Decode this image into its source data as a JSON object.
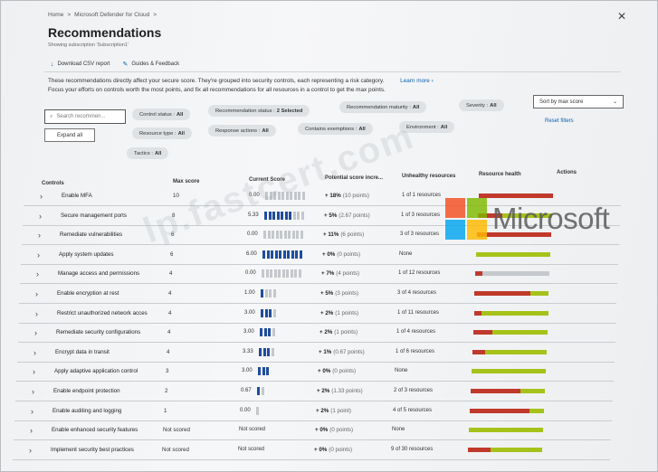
{
  "breadcrumb": [
    "Home",
    ">",
    "Microsoft Defender for Cloud",
    ">"
  ],
  "page": {
    "title": "Recommendations",
    "subtitle": "Showing subscription 'Subscription1'"
  },
  "commands": {
    "download": "Download CSV report",
    "guides": "Guides & Feedback"
  },
  "info": {
    "line1": "These recommendations directly affect your secure score. They're grouped into security controls, each representing a risk category.",
    "line2": "Focus your efforts on controls worth the most points, and fix all recommendations for all resources in a control to get the max points.",
    "learn_more": "Learn more ›"
  },
  "filters": {
    "search_placeholder": "Search recommen...",
    "expand_all": "Expand all",
    "reset": "Reset filters",
    "sort": "Sort by max score",
    "pills": [
      {
        "label": "Control status :",
        "value": "All"
      },
      {
        "label": "Recommendation status :",
        "value": "2 Selected"
      },
      {
        "label": "Recommendation maturity :",
        "value": "All"
      },
      {
        "label": "Severity :",
        "value": "All"
      },
      {
        "label": "Resource type :",
        "value": "All"
      },
      {
        "label": "Response actions :",
        "value": "All"
      },
      {
        "label": "Contains exemptions :",
        "value": "All"
      },
      {
        "label": "Environment :",
        "value": "All"
      },
      {
        "label": "Tactics :",
        "value": "All"
      }
    ]
  },
  "table": {
    "headers": {
      "controls": "Controls",
      "max": "Max score",
      "current": "Current Score",
      "potential": "Potential score incre...",
      "unhealthy": "Unhealthy resources",
      "health": "Resource health",
      "actions": "Actions"
    },
    "rows": [
      {
        "name": "Enable MFA",
        "max": "10",
        "current": "0.00",
        "bars_on": 0,
        "bars_total": 10,
        "potential": "+ 18%",
        "points": "(10 points)",
        "unhealthy": "1 of 1 resources",
        "health": [
          [
            "#c0392b",
            0.3
          ],
          [
            "#c0392b",
            0.7
          ]
        ]
      },
      {
        "name": "Secure management ports",
        "max": "8",
        "current": "5.33",
        "bars_on": 7,
        "bars_total": 10,
        "potential": "+ 5%",
        "points": "(2.67 points)",
        "unhealthy": "1 of 3 resources",
        "health": [
          [
            "#c0392b",
            0.33
          ],
          [
            "#a6c21a",
            0.67
          ]
        ]
      },
      {
        "name": "Remediate vulnerabilities",
        "max": "6",
        "current": "0.00",
        "bars_on": 0,
        "bars_total": 10,
        "potential": "+ 11%",
        "points": "(6 points)",
        "unhealthy": "3 of 3 resources",
        "health": [
          [
            "#c0392b",
            1.0
          ]
        ]
      },
      {
        "name": "Apply system updates",
        "max": "6",
        "current": "6.00",
        "bars_on": 10,
        "bars_total": 10,
        "potential": "+ 0%",
        "points": "(0 points)",
        "unhealthy": "None",
        "health": [
          [
            "#a6c21a",
            1.0
          ]
        ]
      },
      {
        "name": "Manage access and permissions",
        "max": "4",
        "current": "0.00",
        "bars_on": 0,
        "bars_total": 10,
        "potential": "+ 7%",
        "points": "(4 points)",
        "unhealthy": "1 of 12 resources",
        "health": [
          [
            "#c0392b",
            0.1
          ],
          [
            "#c5c8cc",
            0.9
          ]
        ]
      },
      {
        "name": "Enable encryption at rest",
        "max": "4",
        "current": "1.00",
        "bars_on": 1,
        "bars_total": 4,
        "potential": "+ 5%",
        "points": "(3 points)",
        "unhealthy": "3 of 4 resources",
        "health": [
          [
            "#c0392b",
            0.75
          ],
          [
            "#a6c21a",
            0.25
          ]
        ]
      },
      {
        "name": "Restrict unauthorized network acces",
        "max": "4",
        "current": "3.00",
        "bars_on": 3,
        "bars_total": 4,
        "potential": "+ 2%",
        "points": "(1 points)",
        "unhealthy": "1 of 11 resources",
        "health": [
          [
            "#c0392b",
            0.1
          ],
          [
            "#a6c21a",
            0.9
          ]
        ]
      },
      {
        "name": "Remediate security configurations",
        "max": "4",
        "current": "3.00",
        "bars_on": 3,
        "bars_total": 4,
        "potential": "+ 2%",
        "points": "(1 points)",
        "unhealthy": "1 of 4 resources",
        "health": [
          [
            "#c0392b",
            0.25
          ],
          [
            "#a6c21a",
            0.75
          ]
        ]
      },
      {
        "name": "Encrypt data in transit",
        "max": "4",
        "current": "3.33",
        "bars_on": 3,
        "bars_total": 4,
        "potential": "+ 1%",
        "points": "(0.67 points)",
        "unhealthy": "1 of 6 resources",
        "health": [
          [
            "#c0392b",
            0.17
          ],
          [
            "#a6c21a",
            0.83
          ]
        ]
      },
      {
        "name": "Apply adaptive application control",
        "max": "3",
        "current": "3.00",
        "bars_on": 3,
        "bars_total": 3,
        "potential": "+ 0%",
        "points": "(0 points)",
        "unhealthy": "None",
        "health": [
          [
            "#a6c21a",
            1.0
          ]
        ]
      },
      {
        "name": "Enable endpoint protection",
        "max": "2",
        "current": "0.67",
        "bars_on": 1,
        "bars_total": 2,
        "potential": "+ 2%",
        "points": "(1.33 points)",
        "unhealthy": "2 of 3 resources",
        "health": [
          [
            "#c0392b",
            0.67
          ],
          [
            "#a6c21a",
            0.33
          ]
        ]
      },
      {
        "name": "Enable auditing and logging",
        "max": "1",
        "current": "0.00",
        "bars_on": 0,
        "bars_total": 1,
        "potential": "+ 2%",
        "points": "(1 point)",
        "unhealthy": "4 of 5 resources",
        "health": [
          [
            "#c0392b",
            0.8
          ],
          [
            "#a6c21a",
            0.2
          ]
        ]
      },
      {
        "name": "Enable enhanced security features",
        "max": "Not scored",
        "current": "Not scored",
        "bars_on": 0,
        "bars_total": 0,
        "potential": "+ 0%",
        "points": "(0 points)",
        "unhealthy": "None",
        "health": [
          [
            "#a6c21a",
            1.0
          ]
        ]
      },
      {
        "name": "Implement security best practices",
        "max": "Not scored",
        "current": "Not scored",
        "bars_on": 0,
        "bars_total": 0,
        "potential": "+ 0%",
        "points": "(0 points)",
        "unhealthy": "9 of 30 resources",
        "health": [
          [
            "#c0392b",
            0.3
          ],
          [
            "#a6c21a",
            0.7
          ]
        ]
      }
    ]
  },
  "watermark": {
    "text": "lp.fastcert.com",
    "brand": "Microsoft"
  },
  "colors": {
    "accent": "#0b62b3",
    "bar_on": "#1f4d9b",
    "unhealthy": "#c0392b",
    "healthy": "#a6c21a"
  }
}
